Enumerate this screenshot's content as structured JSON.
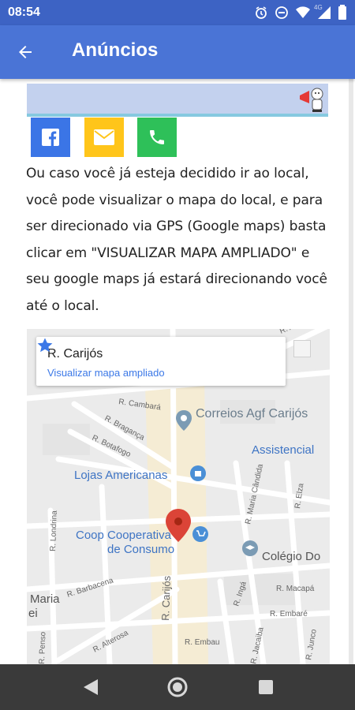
{
  "status": {
    "time": "08:54",
    "network": "4G"
  },
  "appbar": {
    "title": "Anúncios"
  },
  "content": {
    "paragraph": "Ou caso você já esteja decidido ir ao local, você pode visualizar o mapa do local, e para ser direcionado via GPS (Google maps) basta clicar em \"VISUALIZAR MAPA AMPLIADO\" e seu google maps já estará direcionando você até o local.",
    "share_icons": [
      "facebook-icon",
      "mail-icon",
      "phone-icon"
    ],
    "share_colors": {
      "facebook": "#3b75e6",
      "mail": "#ffc51a",
      "phone": "#2ec059"
    }
  },
  "map": {
    "card_title": "R. Carijós",
    "card_link": "Visualizar mapa ampliado",
    "poi": {
      "correios": "Correios Agf Carijós",
      "assistencial": "Assistencial",
      "lojas": "Lojas Americanas",
      "coop_line1": "Coop Cooperativa",
      "coop_line2": "de Consumo",
      "colegio": "Colégio Do",
      "maria": "Maria",
      "ei": "ei"
    },
    "streets": {
      "carijos": "R. Carijós",
      "cambara": "R. Cambará",
      "braganca": "R. Bragança",
      "botafogo": "R. Botafogo",
      "londrina": "R. Londrina",
      "barbacena": "R. Barbacena",
      "alterosa": "R. Alterosa",
      "embau1": "R. Embau",
      "embare": "R. Embaré",
      "macapa": "R. Macapá",
      "inga": "R. Ingá",
      "maria_candida": "R. Maria Cândida",
      "elza": "R. Elza",
      "penso": "R. Penso",
      "jacaiba": "R. Jacaiba",
      "junco": "R. Junco",
      "alto": "R. Alto"
    }
  },
  "colors": {
    "statusbar": "#3d63c4",
    "appbar": "#4a74d6",
    "navbar": "#3a3a3a",
    "pin": "#db4437",
    "poi_blue": "#4a8fd6"
  }
}
